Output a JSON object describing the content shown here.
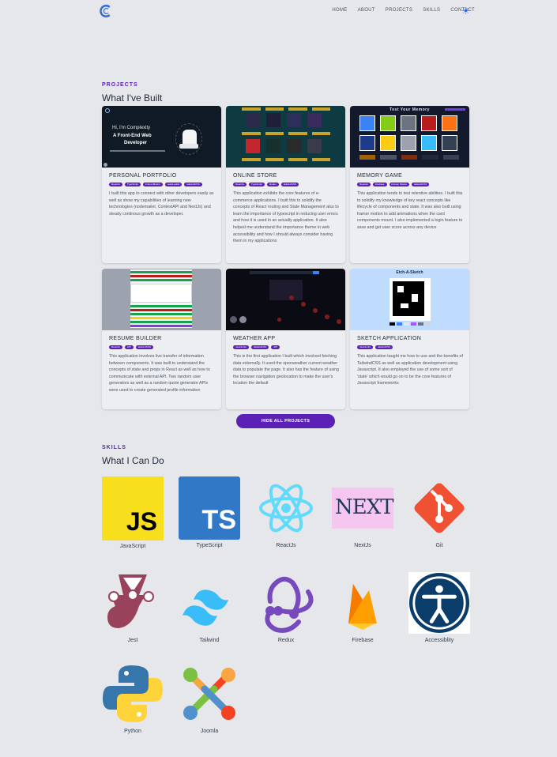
{
  "nav": {
    "links": [
      "HOME",
      "ABOUT",
      "PROJECTS",
      "SKILLS",
      "CONTACT"
    ]
  },
  "projects": {
    "tag": "PROJECTS",
    "title": "What I've Built",
    "cards": [
      {
        "title": "PERSONAL PORTFOLIO",
        "tags": [
          "ReactJs",
          "TypeScript",
          "FramerMotion",
          "reactLeaflet",
          "tailwindCSS"
        ],
        "desc": "I built this app to connect with other developers easily as well as show my capabilities of learning new technologies (nodemailer, ContextAPI and NextJs) and steady continous growth as a developer.",
        "thumb_heading_1": "Hi, I'm Complexity",
        "thumb_heading_2": "A Front-End Web",
        "thumb_heading_3": "Developer"
      },
      {
        "title": "ONLINE STORE",
        "tags": [
          "ReactJs",
          "TypeScript",
          "Redux",
          "tailwindCSS"
        ],
        "desc": "This application exhibits the core features of e-commerce applications. I built this to solidify the concepts of React routing and State Management also to learn the importance of typescript in reducing user errors and how it is used in an actually application. It also helped me understand the importance theme in web accessibility and how I should always consider having them in my applications"
      },
      {
        "title": "MEMORY GAME",
        "tags": [
          "ReactJs",
          "Firebase",
          "Framer Motion",
          "tailwindCSS"
        ],
        "desc": "This application tends to test retentive abilities. I built this to solidify my knowledge of key react concepts like lifecycle of components and state. It was also built using framer motion to add animations when the card components mount. I also implemented a login feature to save and get user score across any device",
        "thumb_heading_1": "Test Your Memory"
      },
      {
        "title": "RESUME BUILDER",
        "tags": [
          "ReactJs",
          "API",
          "tailwindCSS"
        ],
        "desc": "This application involves live transfer of information between components. It was built to understand the concepts of state and props in React as well as how to communicate with external API. Two random user generators as well as a random quote generator APIs were used to create generated profile information"
      },
      {
        "title": "WEATHER APP",
        "tags": [
          "JavaScript",
          "tailwindCSS",
          "API"
        ],
        "desc": "This is the first application I built which involved fetching data externally. It used the openweather current weather data to populate the page. It also has the feature of using the browser navigation geolocation to make the user's location the default"
      },
      {
        "title": "SKETCH APPLICATION",
        "tags": [
          "JavaScript",
          "tailwindCSS"
        ],
        "desc": "This application taught me how to use and the benefits of TailwindCSS as well as application development using Javascript. It also employed the use of some sort of 'state' which would go on to be the core features of Javascript frameworks",
        "thumb_heading_1": "Etch-A-Sketch"
      }
    ],
    "hide_button": "HIDE ALL PROJECTS"
  },
  "skills": {
    "tag": "SKILLS",
    "title": "What I Can Do",
    "items": [
      {
        "name": "JavaScript",
        "icon": "javascript-icon",
        "badge": "JS"
      },
      {
        "name": "TypeScript",
        "icon": "typescript-icon",
        "badge": "TS"
      },
      {
        "name": "ReactJs",
        "icon": "react-icon"
      },
      {
        "name": "NextJs",
        "icon": "nextjs-icon",
        "badge": "NEXT"
      },
      {
        "name": "Git",
        "icon": "git-icon"
      },
      {
        "name": "Jest",
        "icon": "jest-icon"
      },
      {
        "name": "Tailwind",
        "icon": "tailwind-icon"
      },
      {
        "name": "Redux",
        "icon": "redux-icon"
      },
      {
        "name": "Firebase",
        "icon": "firebase-icon"
      },
      {
        "name": "Accessiblity",
        "icon": "accessibility-icon"
      },
      {
        "name": "Python",
        "icon": "python-icon"
      },
      {
        "name": "Joomla",
        "icon": "joomla-icon"
      }
    ]
  },
  "colors": {
    "accent": "#5b21b6",
    "background": "#e5e7eb"
  }
}
